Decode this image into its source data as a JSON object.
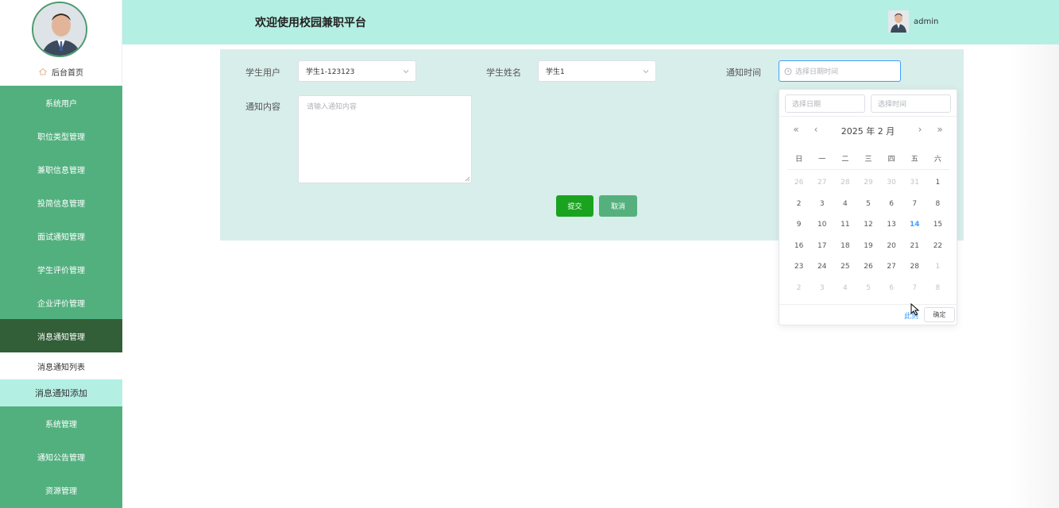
{
  "header": {
    "title": "欢迎使用校园兼职平台",
    "username": "admin"
  },
  "sidebar": {
    "home": "后台首页",
    "items": [
      {
        "label": "系统用户"
      },
      {
        "label": "职位类型管理"
      },
      {
        "label": "兼职信息管理"
      },
      {
        "label": "投简信息管理"
      },
      {
        "label": "面试通知管理"
      },
      {
        "label": "学生评价管理"
      },
      {
        "label": "企业评价管理"
      },
      {
        "label": "消息通知管理"
      }
    ],
    "submenu": [
      {
        "label": "消息通知列表"
      },
      {
        "label": "消息通知添加"
      }
    ],
    "items_after": [
      {
        "label": "系统管理"
      },
      {
        "label": "通知公告管理"
      },
      {
        "label": "资源管理"
      }
    ]
  },
  "form": {
    "student_user_label": "学生用户",
    "student_user_value": "学生1-123123",
    "student_name_label": "学生姓名",
    "student_name_value": "学生1",
    "notify_time_label": "通知时间",
    "notify_time_placeholder": "选择日期时间",
    "content_label": "通知内容",
    "content_placeholder": "请输入通知内容",
    "submit_label": "提交",
    "cancel_label": "取消"
  },
  "datepicker": {
    "date_placeholder": "选择日期",
    "time_placeholder": "选择时间",
    "title": "2025 年  2 月",
    "weekdays": [
      "日",
      "一",
      "二",
      "三",
      "四",
      "五",
      "六"
    ],
    "rows": [
      [
        {
          "d": "26",
          "m": true
        },
        {
          "d": "27",
          "m": true
        },
        {
          "d": "28",
          "m": true
        },
        {
          "d": "29",
          "m": true
        },
        {
          "d": "30",
          "m": true
        },
        {
          "d": "31",
          "m": true
        },
        {
          "d": "1"
        }
      ],
      [
        {
          "d": "2"
        },
        {
          "d": "3"
        },
        {
          "d": "4"
        },
        {
          "d": "5"
        },
        {
          "d": "6"
        },
        {
          "d": "7"
        },
        {
          "d": "8"
        }
      ],
      [
        {
          "d": "9"
        },
        {
          "d": "10"
        },
        {
          "d": "11"
        },
        {
          "d": "12"
        },
        {
          "d": "13"
        },
        {
          "d": "14",
          "t": true
        },
        {
          "d": "15"
        }
      ],
      [
        {
          "d": "16"
        },
        {
          "d": "17"
        },
        {
          "d": "18"
        },
        {
          "d": "19"
        },
        {
          "d": "20"
        },
        {
          "d": "21"
        },
        {
          "d": "22"
        }
      ],
      [
        {
          "d": "23"
        },
        {
          "d": "24"
        },
        {
          "d": "25"
        },
        {
          "d": "26"
        },
        {
          "d": "27"
        },
        {
          "d": "28"
        },
        {
          "d": "1",
          "m": true
        }
      ],
      [
        {
          "d": "2",
          "m": true
        },
        {
          "d": "3",
          "m": true
        },
        {
          "d": "4",
          "m": true
        },
        {
          "d": "5",
          "m": true
        },
        {
          "d": "6",
          "m": true
        },
        {
          "d": "7",
          "m": true
        },
        {
          "d": "8",
          "m": true
        }
      ]
    ],
    "now_label": "此刻",
    "confirm_label": "确定"
  },
  "colors": {
    "sidebar": "#52b07f",
    "sidebar_active": "#325e38",
    "header": "#b4efe3",
    "panel": "#d8eeea",
    "submit": "#1aa31f",
    "cancel": "#55b07e",
    "accent": "#409eff"
  },
  "icons": {
    "home": "home-icon",
    "clock": "clock-icon",
    "dropdown": "chevron-down-icon"
  }
}
